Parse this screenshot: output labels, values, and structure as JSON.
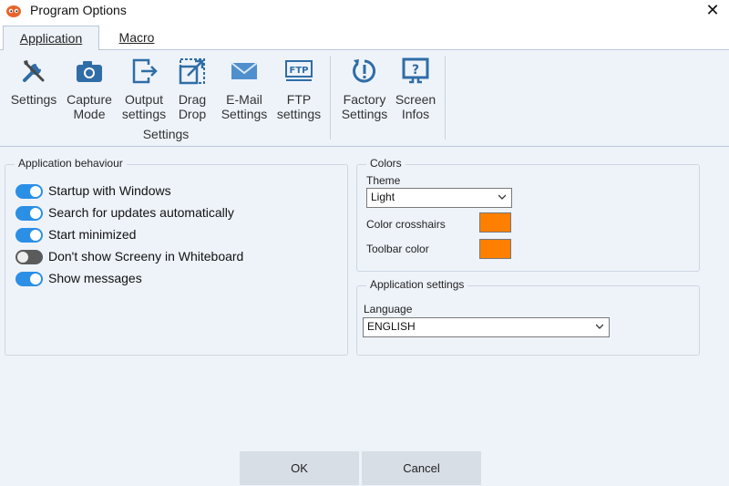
{
  "window": {
    "title": "Program Options",
    "close_glyph": "✕"
  },
  "tabs": [
    {
      "label": "Application",
      "active": true
    },
    {
      "label": "Macro",
      "active": false
    }
  ],
  "ribbon": {
    "buttons": [
      {
        "line1": "Settings",
        "line2": "",
        "icon": "wrench-screwdriver-icon"
      },
      {
        "line1": "Capture",
        "line2": "Mode",
        "icon": "camera-icon"
      },
      {
        "line1": "Output",
        "line2": "settings",
        "icon": "export-icon"
      },
      {
        "line1": "Drag",
        "line2": "Drop",
        "icon": "drag-drop-icon"
      },
      {
        "line1": "E-Mail",
        "line2": "Settings",
        "icon": "envelope-icon"
      },
      {
        "line1": "FTP",
        "line2": "settings",
        "icon": "ftp-icon"
      },
      {
        "line1": "Factory",
        "line2": "Settings",
        "icon": "reset-icon"
      },
      {
        "line1": "Screen",
        "line2": "Infos",
        "icon": "monitor-info-icon"
      }
    ],
    "group_label": "Settings"
  },
  "application_behaviour": {
    "title": "Application behaviour",
    "toggles": [
      {
        "label": "Startup with Windows",
        "on": true
      },
      {
        "label": "Search for updates automatically",
        "on": true
      },
      {
        "label": "Start minimized",
        "on": true
      },
      {
        "label": "Don't show Screeny in Whiteboard",
        "on": false
      },
      {
        "label": "Show messages",
        "on": true
      }
    ]
  },
  "colors": {
    "title": "Colors",
    "theme_label": "Theme",
    "theme_value": "Light",
    "crosshairs_label": "Color crosshairs",
    "crosshairs_color": "#ff8000",
    "toolbar_label": "Toolbar color",
    "toolbar_color": "#ff8000"
  },
  "app_settings": {
    "title": "Application settings",
    "language_label": "Language",
    "language_value": "ENGLISH"
  },
  "footer": {
    "ok_label": "OK",
    "cancel_label": "Cancel"
  },
  "accent_color": "#2b8fe6"
}
